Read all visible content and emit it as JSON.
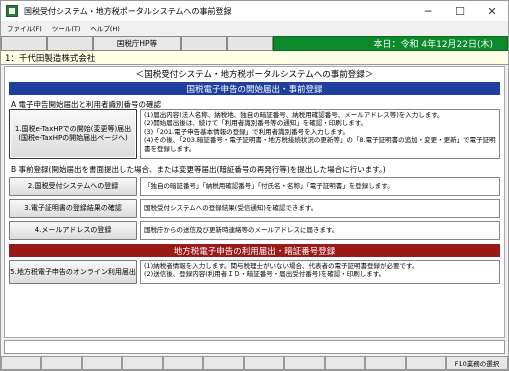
{
  "window": {
    "title": "国税受付システム・地方税ポータルシステムへの事前登録"
  },
  "menu": [
    "ファイル(F)",
    "ツール(T)",
    "ヘルプ(H)"
  ],
  "header": {
    "nta_hp_button": "国税庁HP等",
    "date_text": "本日：令和 4年12月22日(木)",
    "date_bg": "#0a8a2a"
  },
  "company": "1：千代田製造株式会社",
  "page_title": "＜国税受付システム・地方税ポータルシステムへの事前登録＞",
  "band1": "国税電子申告の開始届出・事前登録",
  "sectionA": "A 電子申告開始届出と利用者識別番号の確認",
  "sectionB": "B 事前登録(開始届出を書面提出した場合、または変更等届出(暗証番号の再発行等)を提出した場合に行います。)",
  "band2": "地方税電子申告の利用届出・暗証番号登録",
  "rows": [
    {
      "button": "1.国税e-TaxHPでの開始(変更等)届出\n(国税e-TaxHPの開始届出ページへ)",
      "desc": "(1)届出内容(法人名称、納税地、独自の暗証番号、納税用確認番号、メールアドレス等)を入力します。\n(2)開始届出後は、続けて「利用者識別番号等の通知」を確認・印刷します。\n(3)「201.電子申告基本情報の登録」で利用者識別番号を入力します。\n(4)その後、「203.暗証番号・電子証明書・地方税接続状況の更新等」の「8.電子証明書の追加・変更・更新」で電子証明書を登録します。"
    },
    {
      "button": "2.国税受付システムへの登録",
      "desc": "「独自の暗証番号」「納税用確認番号」「付氏名・名称」「電子証明書」を登録します。"
    },
    {
      "button": "3.電子証明書の登録結果の確認",
      "desc": "国税受付システムへの登録結果(受信通知)を確認できます。"
    },
    {
      "button": "4.メールアドレスの登録",
      "desc": "国税庁からの送信及び更新時連絡等のメールアドレスに届きます。"
    },
    {
      "button": "5.地方税電子申告のオンライン利用届出",
      "desc": "(1)納税者情報を入力します。関与税理士がいない場合、代表者の電子証明書登録が必要です。\n(2)送信後、登録内容(利用者ＩＤ・暗証番号・届出受付番号)を確認・印刷します。"
    }
  ],
  "fkeys": [
    "",
    "",
    "",
    "",
    "",
    "",
    "",
    "",
    "",
    "",
    "",
    "F10業務の選択"
  ],
  "colors": {
    "blue_band": "#1f3f9f",
    "red_band": "#9a1a1a",
    "company_bg": "#ffffe6"
  }
}
